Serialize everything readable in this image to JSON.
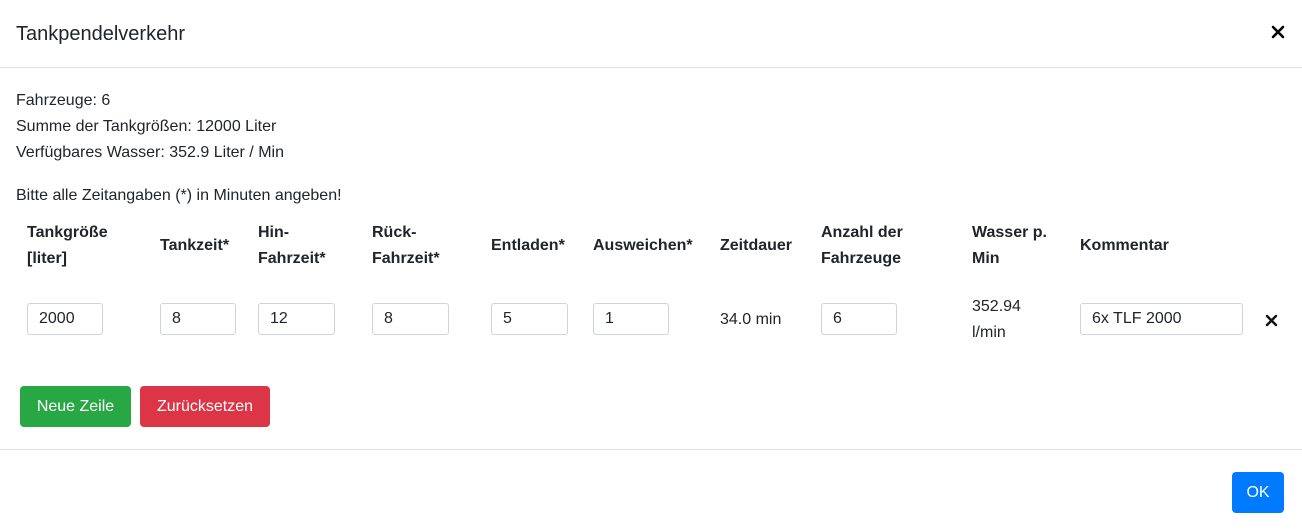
{
  "header": {
    "title": "Tankpendelverkehr"
  },
  "summary": {
    "vehicles": "Fahrzeuge: 6",
    "tank_sum": "Summe der Tankgrößen: 12000 Liter",
    "water": "Verfügbares Wasser: 352.9 Liter / Min",
    "hint": "Bitte alle Zeitangaben (*) in Minuten angeben!"
  },
  "table": {
    "headers": {
      "tank_size_1": "Tankgröße",
      "tank_size_2": "[liter]",
      "tank_time": "Tankzeit*",
      "drive_to_1": "Hin-",
      "drive_to_2": "Fahrzeit*",
      "drive_back_1": "Rück-",
      "drive_back_2": "Fahrzeit*",
      "unload": "Entladen*",
      "evade": "Ausweichen*",
      "duration": "Zeitdauer",
      "vehicle_count_1": "Anzahl der",
      "vehicle_count_2": "Fahrzeuge",
      "water_per_min_1": "Wasser p.",
      "water_per_min_2": "Min",
      "comment": "Kommentar"
    },
    "rows": [
      {
        "tank_size": "2000",
        "tank_time": "8",
        "drive_to": "12",
        "drive_back": "8",
        "unload": "5",
        "evade": "1",
        "duration": "34.0 min",
        "vehicle_count": "6",
        "water_1": "352.94",
        "water_2": "l/min",
        "comment": "6x TLF 2000"
      }
    ]
  },
  "buttons": {
    "new_row": "Neue Zeile",
    "reset": "Zurücksetzen",
    "ok": "OK"
  },
  "colors": {
    "green": "#28a745",
    "red": "#dc3545",
    "blue": "#007bff"
  },
  "icons": {
    "close": "close-icon",
    "remove_row": "close-icon"
  }
}
